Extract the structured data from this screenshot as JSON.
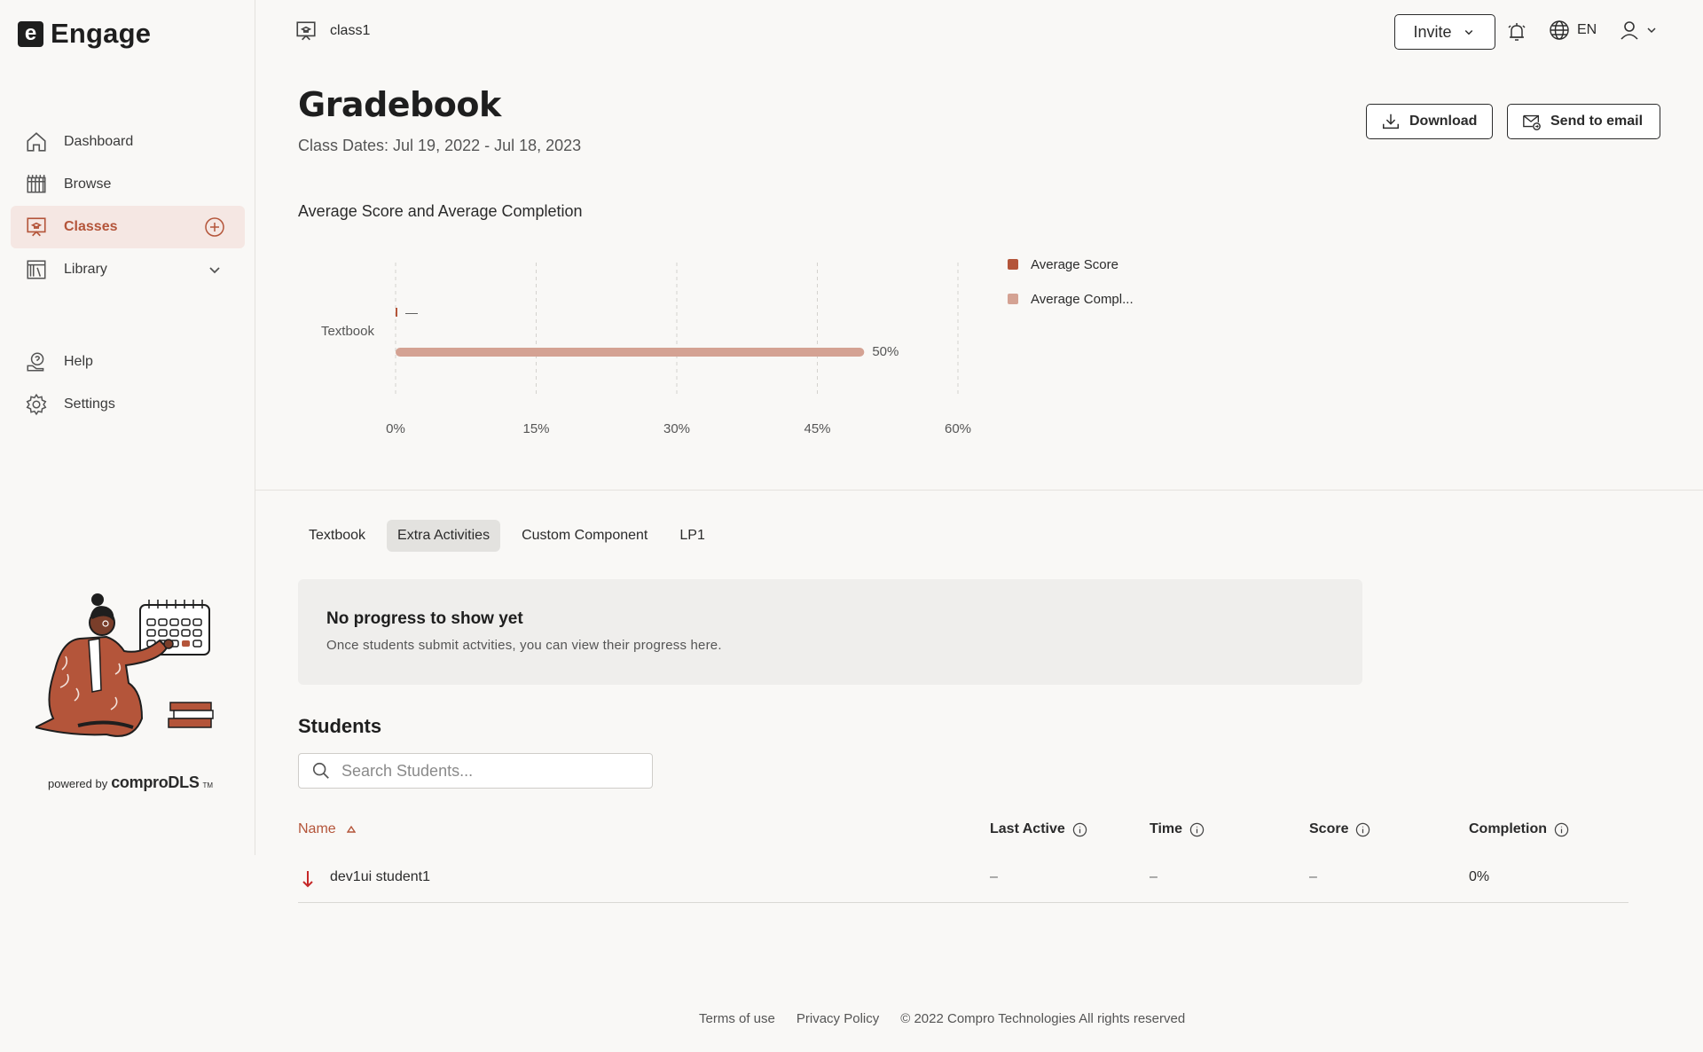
{
  "brand": {
    "logo_letter": "e",
    "name": "Engage"
  },
  "sidebar": {
    "items": [
      {
        "label": "Dashboard",
        "icon": "home-icon"
      },
      {
        "label": "Browse",
        "icon": "browse-icon"
      },
      {
        "label": "Classes",
        "icon": "classes-icon",
        "active": true,
        "trailing_icon": "add-circle-icon"
      },
      {
        "label": "Library",
        "icon": "library-icon",
        "trailing_icon": "chevron-down-icon"
      }
    ],
    "secondary_items": [
      {
        "label": "Help",
        "icon": "help-icon"
      },
      {
        "label": "Settings",
        "icon": "gear-icon"
      }
    ],
    "powered_by": {
      "prefix": "powered by",
      "product": "comproDLS",
      "mark": "TM"
    }
  },
  "topbar": {
    "class_name": "class1",
    "invite_label": "Invite",
    "language": "EN"
  },
  "header": {
    "title": "Gradebook",
    "class_dates": "Class Dates: Jul 19, 2022 - Jul 18, 2023",
    "download_label": "Download",
    "email_label": "Send to email"
  },
  "chart_data": {
    "type": "bar",
    "orientation": "horizontal",
    "title": "Average Score and Average Completion",
    "categories": [
      "Textbook"
    ],
    "series": [
      {
        "name": "Average Score",
        "values": [
          null
        ],
        "data_label": "—",
        "color": "#b4553a"
      },
      {
        "name": "Average Compl...",
        "values": [
          50
        ],
        "data_label": "50%",
        "color": "#d4a293"
      }
    ],
    "xlim": [
      0,
      60
    ],
    "x_ticks": [
      "0%",
      "15%",
      "30%",
      "45%",
      "60%"
    ],
    "grid": "vertical dashed",
    "legend_position": "right"
  },
  "tabs": [
    {
      "label": "Textbook"
    },
    {
      "label": "Extra Activities",
      "active": true
    },
    {
      "label": "Custom Component"
    },
    {
      "label": "LP1"
    }
  ],
  "empty_state": {
    "title": "No progress to show yet",
    "description": "Once students submit actvities, you can view their progress here."
  },
  "students": {
    "title": "Students",
    "search_placeholder": "Search Students...",
    "columns": {
      "name": "Name",
      "last_active": "Last Active",
      "time": "Time",
      "score": "Score",
      "completion": "Completion"
    },
    "rows": [
      {
        "name": "dev1ui student1",
        "last_active": "–",
        "time": "–",
        "score": "–",
        "completion": "0%",
        "trend_icon": "arrow-down-icon"
      }
    ]
  },
  "footer": {
    "terms": "Terms of use",
    "privacy": "Privacy Policy",
    "copyright": "© 2022 Compro Technologies All rights reserved"
  },
  "colors": {
    "accent": "#b4553a",
    "accent_light": "#d4a293",
    "active_nav_bg": "#f5e7e3",
    "background": "#f9f8f6"
  }
}
